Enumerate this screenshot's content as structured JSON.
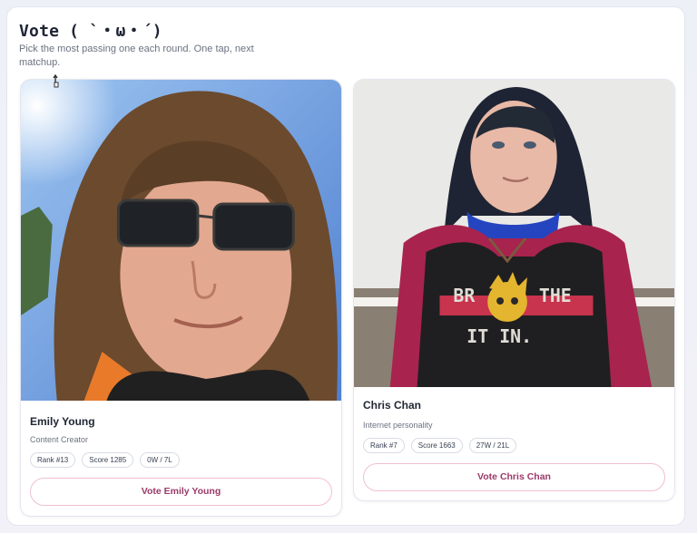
{
  "header": {
    "title": "Vote ( `・ω・´)",
    "subtitle": "Pick the most passing one each round. One tap, next matchup."
  },
  "matchup": [
    {
      "name": "Emily Young",
      "role": "Content Creator",
      "rank": "Rank #13",
      "score": "Score 1285",
      "record": "0W / 7L",
      "vote_label": "Vote Emily Young",
      "photo": "portrait-photo"
    },
    {
      "name": "Chris Chan",
      "role": "Internet personality",
      "rank": "Rank #7",
      "score": "Score 1663",
      "record": "27W / 21L",
      "vote_label": "Vote Chris Chan",
      "photo": "portrait-photo",
      "shirt_text": [
        "BR",
        "THE",
        "IT IN."
      ]
    }
  ],
  "colors": {
    "accent": "#9b3a6a",
    "button_border": "#f0bfd2",
    "title": "#1e2433"
  }
}
